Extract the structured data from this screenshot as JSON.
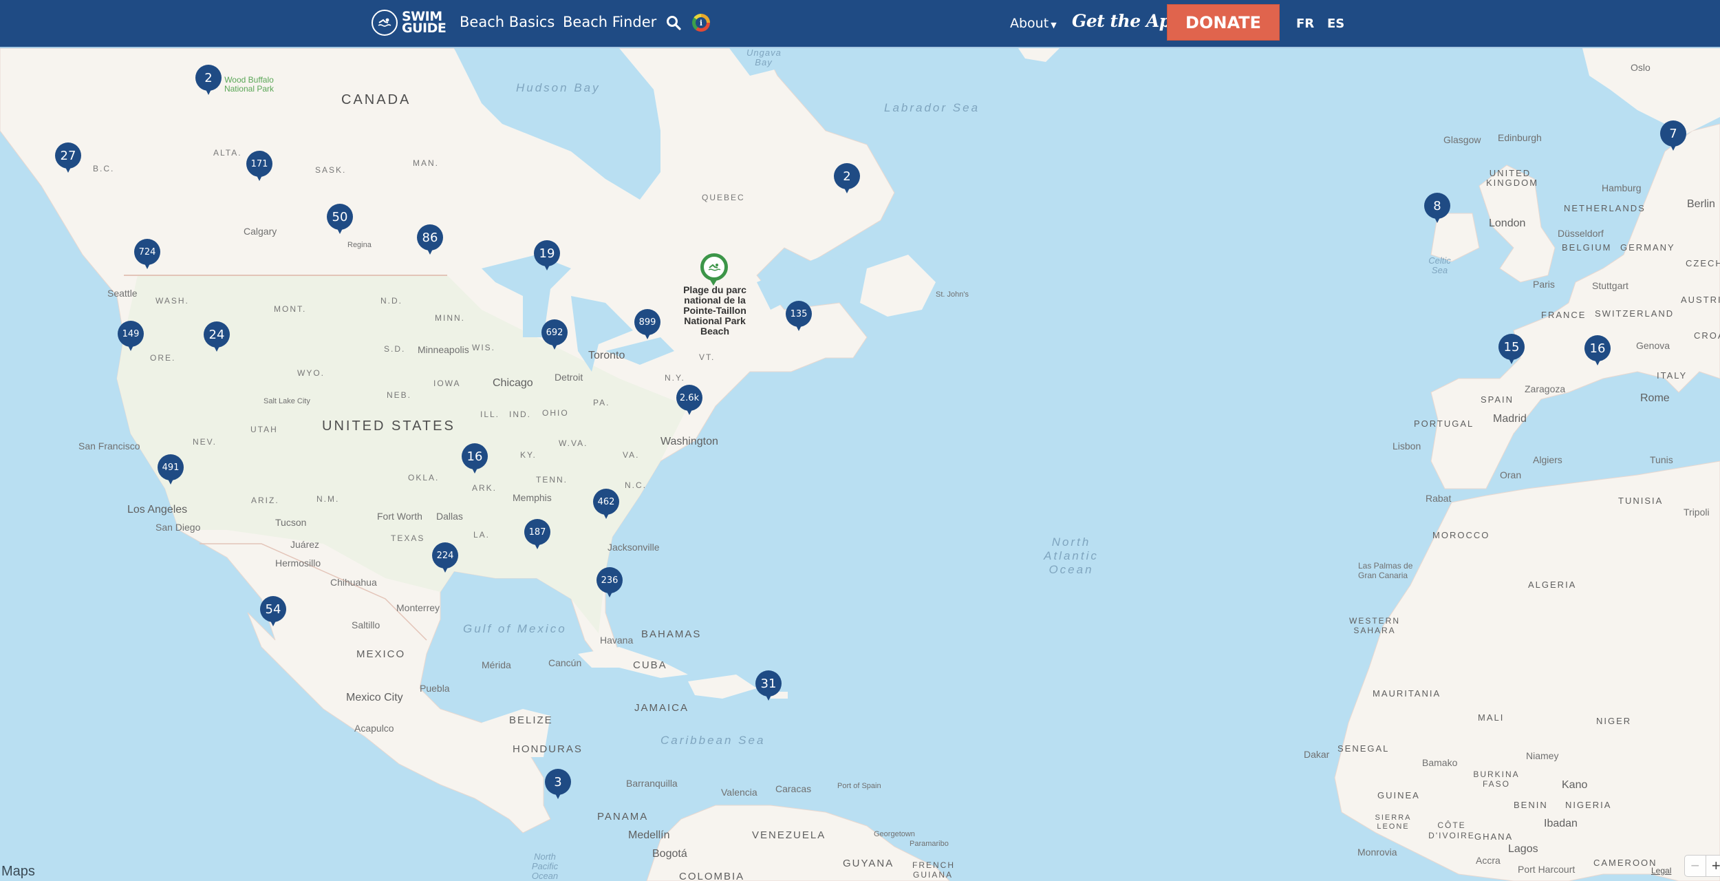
{
  "header": {
    "logo_line1": "SWIM",
    "logo_line2": "GUIDE",
    "nav": [
      "Beach Basics",
      "Beach Finder"
    ],
    "about_label": "About",
    "get_app_label": "Get the App",
    "donate_label": "DONATE",
    "languages": [
      "FR",
      "ES"
    ],
    "icons": {
      "search": "search-icon",
      "info": "info-icon",
      "logo": "swimmer-icon"
    },
    "colors": {
      "bar": "#1f4b84",
      "donate": "#e0644d"
    }
  },
  "map": {
    "provider_label": "Maps",
    "legal_label": "Legal",
    "zoom_out": "−",
    "zoom_in": "+",
    "selected_beach": "Plage du parc national de la Pointe-Taillon National Park Beach",
    "clusters": [
      "2",
      "27",
      "171",
      "50",
      "86",
      "19",
      "724",
      "149",
      "24",
      "692",
      "899",
      "135",
      "2.6k",
      "491",
      "16",
      "462",
      "187",
      "224",
      "236",
      "54",
      "31",
      "3",
      "2",
      "8",
      "7",
      "15",
      "16"
    ],
    "labels": {
      "countries": [
        "CANADA",
        "UNITED STATES",
        "MEXICO",
        "CUBA",
        "BAHAMAS",
        "JAMAICA",
        "BELIZE",
        "HONDURAS",
        "PANAMA",
        "VENEZUELA",
        "COLOMBIA",
        "GUYANA",
        "FRENCH GUIANA",
        "UNITED KINGDOM",
        "NETHERLANDS",
        "BELGIUM",
        "GERMANY",
        "CZECHIA",
        "AUSTRIA",
        "FRANCE",
        "SWITZERLAND",
        "ITALY",
        "CROATIA",
        "SPAIN",
        "PORTUGAL",
        "MOROCCO",
        "ALGERIA",
        "TUNISIA",
        "WESTERN SAHARA",
        "MAURITANIA",
        "MALI",
        "NIGER",
        "SENEGAL",
        "GUINEA",
        "SIERRA LEONE",
        "CÔTE D'IVOIRE",
        "GHANA",
        "BURKINA FASO",
        "BENIN",
        "NIGERIA",
        "CAMEROON"
      ],
      "regions": [
        "B.C.",
        "ALTA.",
        "SASK.",
        "MAN.",
        "QUEBEC",
        "WASH.",
        "ORE.",
        "MONT.",
        "WYO.",
        "N.D.",
        "S.D.",
        "NEB.",
        "MINN.",
        "IOWA",
        "WIS.",
        "ILL.",
        "IND.",
        "OHIO",
        "PA.",
        "N.Y.",
        "VT.",
        "W.VA.",
        "VA.",
        "KY.",
        "TENN.",
        "N.C.",
        "ARK.",
        "OKLA.",
        "LA.",
        "TEXAS",
        "NEV.",
        "UTAH",
        "ARIZ.",
        "N.M."
      ],
      "cities": [
        "Calgary",
        "Regina",
        "Seattle",
        "Minneapolis",
        "Chicago",
        "Detroit",
        "Toronto",
        "Washington",
        "Salt Lake City",
        "San Francisco",
        "Los Angeles",
        "San Diego",
        "Tucson",
        "Juárez",
        "Hermosillo",
        "Chihuahua",
        "Fort Worth",
        "Dallas",
        "Memphis",
        "Jacksonville",
        "Monterrey",
        "Saltillo",
        "Mexico City",
        "Puebla",
        "Acapulco",
        "Mérida",
        "Cancún",
        "Havana",
        "Barranquilla",
        "Valencia",
        "Caracas",
        "Port of Spain",
        "Medellín",
        "Bogotá",
        "Georgetown",
        "Paramaribo",
        "St. John's",
        "Oslo",
        "Glasgow",
        "Edinburgh",
        "Hamburg",
        "Berlin",
        "London",
        "Düsseldorf",
        "Paris",
        "Stuttgart",
        "Genova",
        "Zaragoza",
        "Madrid",
        "Lisbon",
        "Rome",
        "Algiers",
        "Oran",
        "Tunis",
        "Tripoli",
        "Rabat",
        "Las Palmas de Gran Canaria",
        "Dakar",
        "Bamako",
        "Niamey",
        "Kano",
        "Ibadan",
        "Lagos",
        "Accra",
        "Monrovia",
        "Port Harcourt"
      ],
      "water": [
        "Hudson Bay",
        "Ungava Bay",
        "Labrador Sea",
        "North Atlantic Ocean",
        "Gulf of Mexico",
        "Caribbean Sea",
        "Celtic Sea",
        "North Pacific Ocean"
      ],
      "parks": [
        "Wood Buffalo National Park"
      ]
    }
  }
}
